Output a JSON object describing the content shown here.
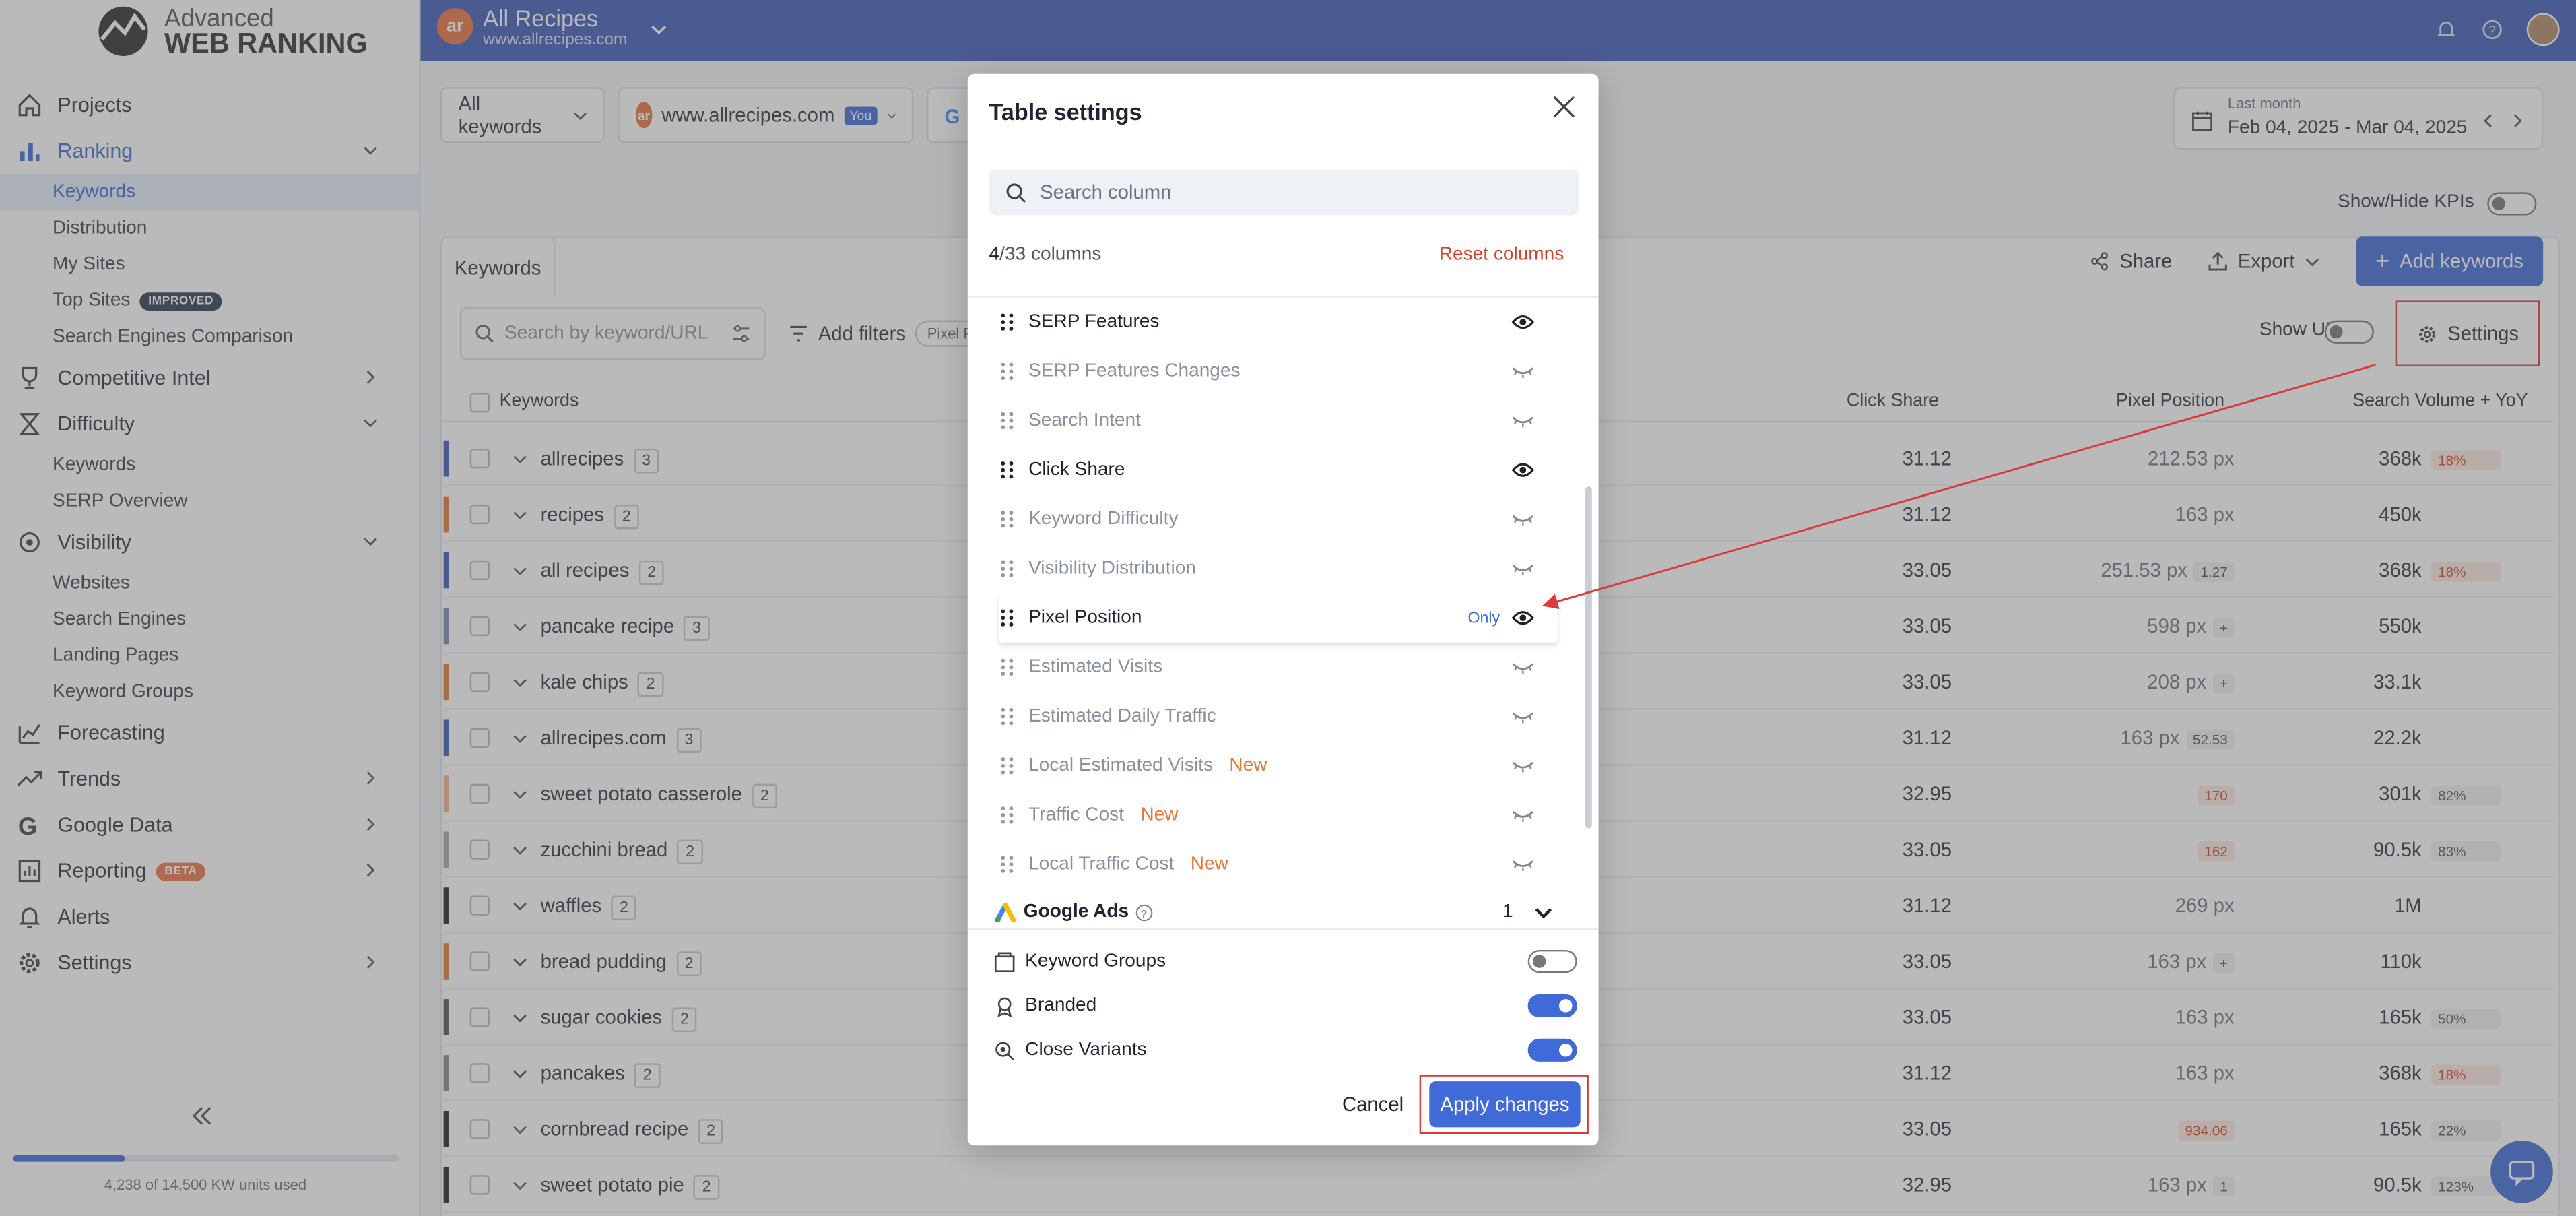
{
  "brand": {
    "line1": "Advanced",
    "line2": "WEB RANKING"
  },
  "sidebar": {
    "items": [
      {
        "label": "Projects",
        "icon": "home-icon"
      },
      {
        "label": "Ranking",
        "icon": "bar-chart-icon",
        "active": true
      },
      {
        "label": "Competitive Intel",
        "icon": "trophy-icon"
      },
      {
        "label": "Difficulty",
        "icon": "hourglass-icon"
      },
      {
        "label": "Visibility",
        "icon": "eye-gear-icon"
      },
      {
        "label": "Forecasting",
        "icon": "forecast-chart-icon"
      },
      {
        "label": "Trends",
        "icon": "trend-icon"
      },
      {
        "label": "Google Data",
        "icon": "google-icon"
      },
      {
        "label": "Reporting",
        "icon": "report-icon",
        "badge": "BETA"
      },
      {
        "label": "Alerts",
        "icon": "bell-icon"
      },
      {
        "label": "Settings",
        "icon": "gear-icon"
      }
    ],
    "ranking_sub": [
      "Keywords",
      "Distribution",
      "My Sites",
      "Top Sites",
      "Search Engines Comparison"
    ],
    "top_sites_badge": "IMPROVED",
    "difficulty_sub": [
      "Keywords",
      "SERP Overview"
    ],
    "visibility_sub": [
      "Websites",
      "Search Engines",
      "Landing Pages",
      "Keyword Groups"
    ],
    "usage": "4,238 of 14,500 KW units used",
    "usage_fraction": 0.29
  },
  "header": {
    "project_initials": "ar",
    "project_name": "All Recipes",
    "project_url": "www.allrecipes.com"
  },
  "toolbar": {
    "keywords_filter": "All keywords",
    "site": "www.allrecipes.com",
    "you_badge": "You",
    "date_label": "Last month",
    "date_range": "Feb 04, 2025 - Mar 04, 2025",
    "kpi_toggle": "Show/Hide KPIs"
  },
  "card": {
    "tab": "Keywords",
    "share": "Share",
    "export": "Export",
    "add_keywords": "Add keywords",
    "search_placeholder": "Search by keyword/URL",
    "add_filters": "Add filters",
    "filter_chip": "Pixel P",
    "show_urls": "Show URLs",
    "settings": "Settings"
  },
  "table": {
    "headers": {
      "keywords": "Keywords",
      "click_share": "Click Share",
      "pixel_position": "Pixel Position",
      "search_volume": "Search Volume + YoY"
    },
    "rows": [
      {
        "kw": "allrecipes",
        "n": "3",
        "color": "#3f5cb8",
        "cs": "31.12",
        "pp": "212.53 px",
        "ppchg": "",
        "sv": "368k",
        "yoy": "18%",
        "yoydir": "dn"
      },
      {
        "kw": "recipes",
        "n": "2",
        "color": "#e07a3a",
        "cs": "31.12",
        "pp": "163 px",
        "ppchg": "",
        "sv": "450k",
        "yoy": "",
        "yoydir": ""
      },
      {
        "kw": "all recipes",
        "n": "2",
        "color": "#3f5cb8",
        "cs": "33.05",
        "pp": "251.53 px",
        "ppchg": "1.27",
        "sv": "368k",
        "yoy": "18%",
        "yoydir": "dn"
      },
      {
        "kw": "pancake recipe",
        "n": "3",
        "color": "#7b8ab8",
        "cs": "33.05",
        "pp": "598 px",
        "ppchg": "+",
        "sv": "550k",
        "yoy": "",
        "yoydir": ""
      },
      {
        "kw": "kale chips",
        "n": "2",
        "color": "#e07a3a",
        "cs": "33.05",
        "pp": "208 px",
        "ppchg": "+",
        "sv": "33.1k",
        "yoy": "",
        "yoydir": ""
      },
      {
        "kw": "allrecipes.com",
        "n": "3",
        "color": "#3f5cb8",
        "cs": "31.12",
        "pp": "163 px",
        "ppchg": "52.53",
        "sv": "22.2k",
        "yoy": "",
        "yoydir": ""
      },
      {
        "kw": "sweet potato casserole",
        "n": "2",
        "color": "#f0b08a",
        "cs": "32.95",
        "pp": "",
        "ppchg": "170",
        "sv": "301k",
        "yoy": "82%",
        "yoydir": "up"
      },
      {
        "kw": "zucchini bread",
        "n": "2",
        "color": "#aaaaaa",
        "cs": "33.05",
        "pp": "",
        "ppchg": "162",
        "sv": "90.5k",
        "yoy": "83%",
        "yoydir": "up"
      },
      {
        "kw": "waffles",
        "n": "2",
        "color": "#222222",
        "cs": "31.12",
        "pp": "269 px",
        "ppchg": "",
        "sv": "1M",
        "yoy": "",
        "yoydir": ""
      },
      {
        "kw": "bread pudding",
        "n": "2",
        "color": "#e07a3a",
        "cs": "33.05",
        "pp": "163 px",
        "ppchg": "+",
        "sv": "110k",
        "yoy": "",
        "yoydir": ""
      },
      {
        "kw": "sugar cookies",
        "n": "2",
        "color": "#555555",
        "cs": "33.05",
        "pp": "163 px",
        "ppchg": "",
        "sv": "165k",
        "yoy": "50%",
        "yoydir": "up"
      },
      {
        "kw": "pancakes",
        "n": "2",
        "color": "#888888",
        "cs": "31.12",
        "pp": "163 px",
        "ppchg": "",
        "sv": "368k",
        "yoy": "18%",
        "yoydir": "dn"
      },
      {
        "kw": "cornbread recipe",
        "n": "2",
        "color": "#222222",
        "cs": "33.05",
        "pp": "",
        "ppchg": "934.06",
        "sv": "165k",
        "yoy": "22%",
        "yoydir": "up"
      },
      {
        "kw": "sweet potato pie",
        "n": "2",
        "color": "#222222",
        "cs": "32.95",
        "pp": "163 px",
        "ppchg": "1",
        "sv": "90.5k",
        "yoy": "123%",
        "yoydir": "up"
      }
    ]
  },
  "modal": {
    "title": "Table settings",
    "search_placeholder": "Search column",
    "count_visible": "4",
    "count_total": "/33 columns",
    "reset": "Reset columns",
    "columns": [
      {
        "name": "SERP Features",
        "visible": true,
        "new": ""
      },
      {
        "name": "SERP Features Changes",
        "visible": false,
        "new": ""
      },
      {
        "name": "Search Intent",
        "visible": false,
        "new": ""
      },
      {
        "name": "Click Share",
        "visible": true,
        "new": ""
      },
      {
        "name": "Keyword Difficulty",
        "visible": false,
        "new": ""
      },
      {
        "name": "Visibility Distribution",
        "visible": false,
        "new": ""
      },
      {
        "name": "Pixel Position",
        "visible": true,
        "new": "",
        "only": "Only"
      },
      {
        "name": "Estimated Visits",
        "visible": false,
        "new": ""
      },
      {
        "name": "Estimated Daily Traffic",
        "visible": false,
        "new": ""
      },
      {
        "name": "Local Estimated Visits",
        "visible": false,
        "new": "New"
      },
      {
        "name": "Traffic Cost",
        "visible": false,
        "new": "New"
      },
      {
        "name": "Local Traffic Cost",
        "visible": false,
        "new": "New"
      }
    ],
    "google_ads": {
      "label": "Google Ads",
      "count": "1"
    },
    "toggles": [
      {
        "label": "Keyword Groups",
        "on": false,
        "icon": "folder-icon"
      },
      {
        "label": "Branded",
        "on": true,
        "icon": "ribbon-icon"
      },
      {
        "label": "Close Variants",
        "on": true,
        "icon": "search-variant-icon"
      }
    ],
    "cancel": "Cancel",
    "apply": "Apply changes"
  },
  "colors": {
    "accent": "#3f6ad8",
    "header": "#3f5cb8",
    "danger": "#d93b3b",
    "new": "#e07a3a"
  }
}
